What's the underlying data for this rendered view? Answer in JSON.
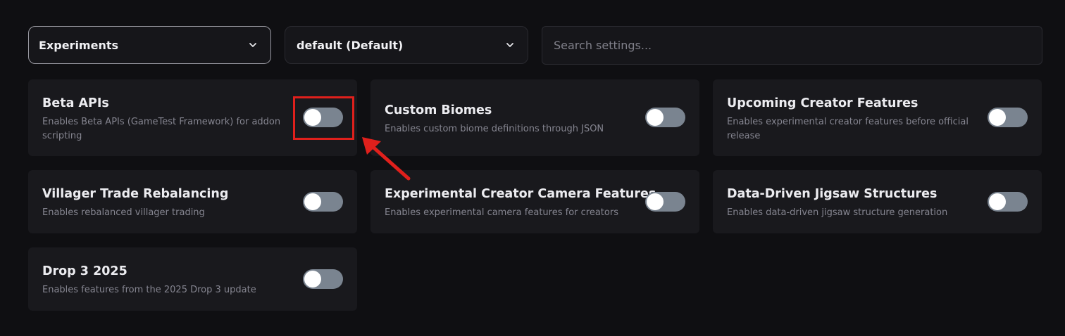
{
  "filters": {
    "category": {
      "value": "Experiments"
    },
    "profile": {
      "value": "default (Default)"
    },
    "search": {
      "placeholder": "Search settings...",
      "value": ""
    }
  },
  "icons": {
    "dropdown": "chevron-down-icon",
    "annotation": "arrow-up-left-icon"
  },
  "colors": {
    "background": "#0f0f12",
    "card": "#19191d",
    "toggle_off": "#7a8490",
    "highlight": "#e0201c"
  },
  "settings": [
    {
      "title": "Beta APIs",
      "description": "Enables Beta APIs (GameTest Framework) for addon scripting",
      "enabled": false,
      "highlighted": true
    },
    {
      "title": "Custom Biomes",
      "description": "Enables custom biome definitions through JSON",
      "enabled": false
    },
    {
      "title": "Upcoming Creator Features",
      "description": "Enables experimental creator features before official release",
      "enabled": false
    },
    {
      "title": "Villager Trade Rebalancing",
      "description": "Enables rebalanced villager trading",
      "enabled": false
    },
    {
      "title": "Experimental Creator Camera Features",
      "description": "Enables experimental camera features for creators",
      "enabled": false
    },
    {
      "title": "Data-Driven Jigsaw Structures",
      "description": "Enables data-driven jigsaw structure generation",
      "enabled": false
    },
    {
      "title": "Drop 3 2025",
      "description": "Enables features from the 2025 Drop 3 update",
      "enabled": false
    }
  ]
}
